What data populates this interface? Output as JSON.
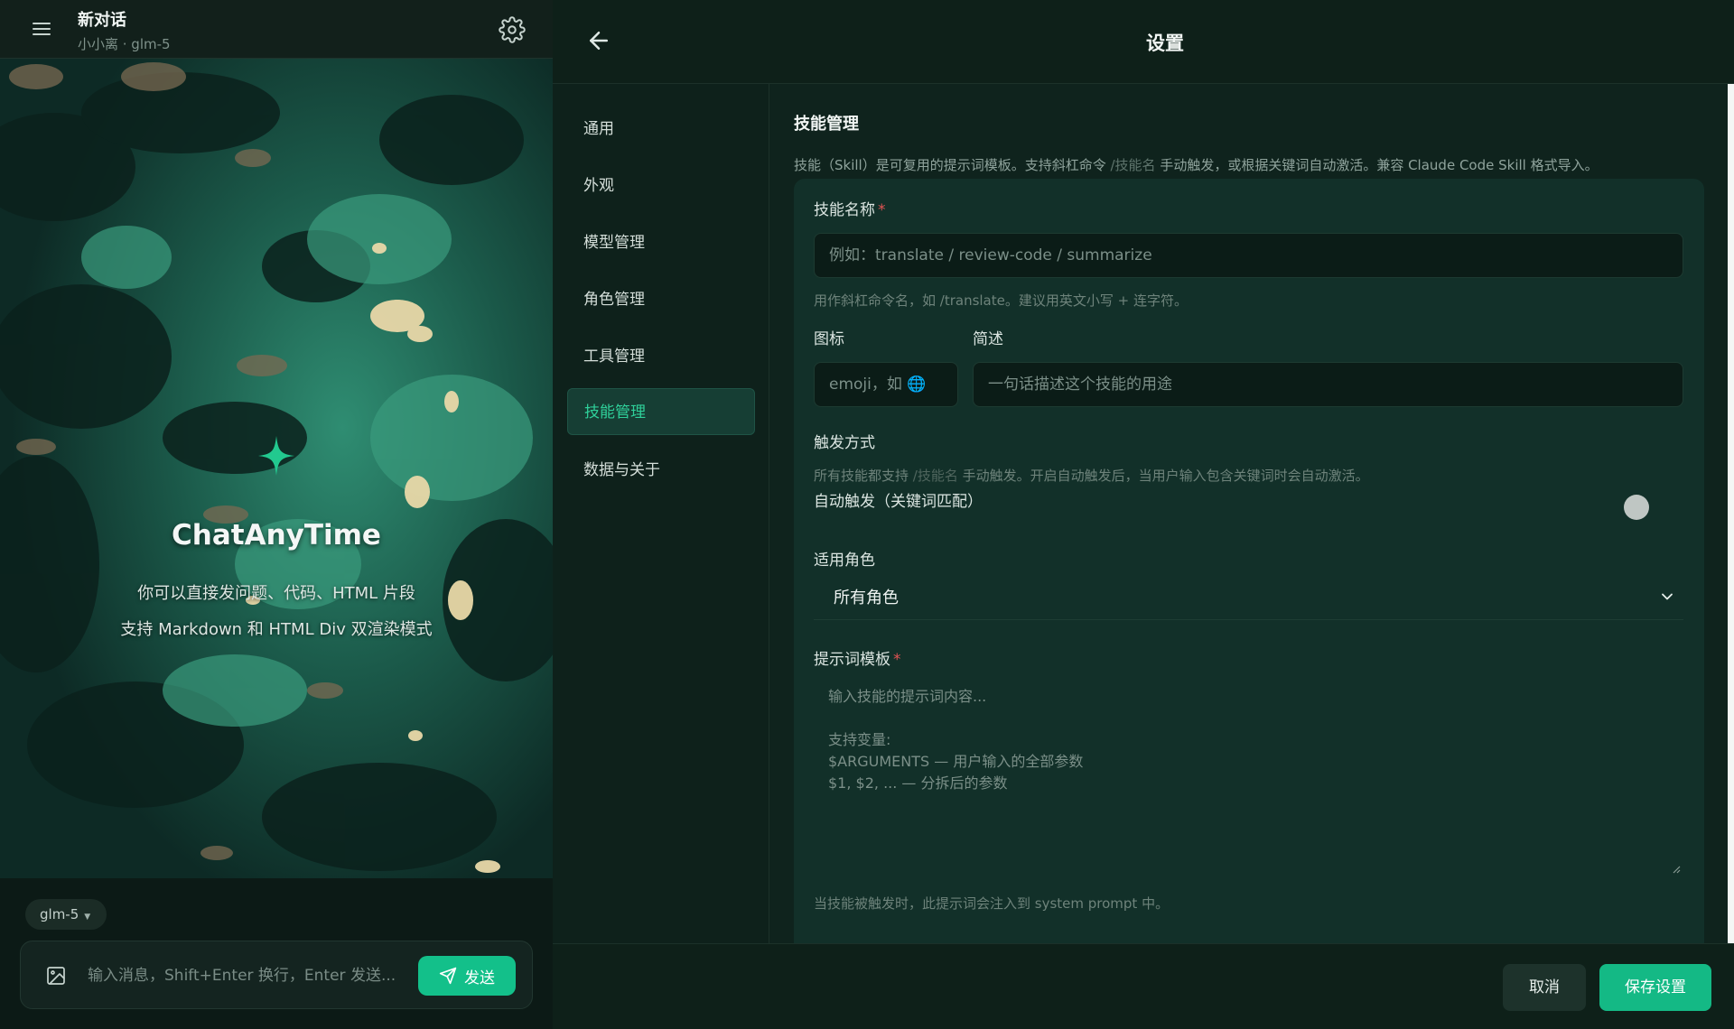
{
  "chat": {
    "title": "新对话",
    "subtitle": "小小离 · glm-5",
    "hero_title": "ChatAnyTime",
    "hero_line1": "你可以直接发问题、代码、HTML 片段",
    "hero_line2": "支持 Markdown 和 HTML Div 双渲染模式",
    "model_chip": "glm-5",
    "input_placeholder": "输入消息，Shift+Enter 换行，Enter 发送...",
    "send_label": "发送"
  },
  "settings": {
    "title": "设置",
    "nav": [
      {
        "label": "通用"
      },
      {
        "label": "外观"
      },
      {
        "label": "模型管理"
      },
      {
        "label": "角色管理"
      },
      {
        "label": "工具管理"
      },
      {
        "label": "技能管理"
      },
      {
        "label": "数据与关于"
      }
    ],
    "active_nav": "技能管理",
    "section_title": "技能管理",
    "section_desc_a": "技能（Skill）是可复用的提示词模板。支持斜杠命令 ",
    "section_desc_cmd": "/技能名",
    "section_desc_b": " 手动触发，或根据关键词自动激活。兼容 Claude Code Skill 格式导入。",
    "form": {
      "name_label": "技能名称",
      "name_placeholder": "例如：translate / review-code / summarize",
      "name_hint": "用作斜杠命令名，如 /translate。建议用英文小写 + 连字符。",
      "icon_label": "图标",
      "icon_placeholder": "emoji，如 🌐",
      "desc_label": "简述",
      "desc_placeholder": "一句话描述这个技能的用途",
      "trigger_label": "触发方式",
      "trigger_hint_a": "所有技能都支持 ",
      "trigger_hint_cmd": "/技能名",
      "trigger_hint_b": " 手动触发。开启自动触发后，当用户输入包含关键词时会自动激活。",
      "auto_trigger_label": "自动触发（关键词匹配）",
      "auto_trigger_on": false,
      "role_label": "适用角色",
      "role_value": "所有角色",
      "prompt_label": "提示词模板",
      "prompt_placeholder": "输入技能的提示词内容...\n\n支持变量:\n$ARGUMENTS — 用户输入的全部参数\n$1, $2, ... — 分拆后的参数",
      "prompt_hint": "当技能被触发时，此提示词会注入到 system prompt 中。"
    },
    "cancel_label": "取消",
    "save_label": "保存设置"
  },
  "colors": {
    "accent": "#13c08a",
    "active_nav_text": "#2fd09a",
    "required": "#e05353"
  }
}
